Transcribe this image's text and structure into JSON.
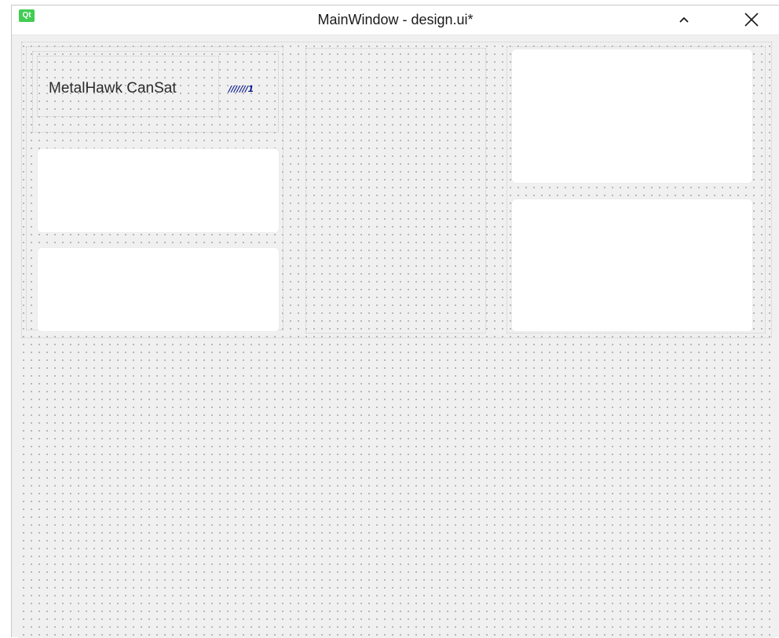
{
  "window": {
    "logo_text": "Qt",
    "title": "MainWindow - design.ui*"
  },
  "titlebar": {
    "collapse_icon": "chevron-up-icon",
    "close_icon": "close-icon"
  },
  "form": {
    "label": {
      "text": "MetalHawk CanSat"
    },
    "placeholder_widget": {
      "text": "///////1"
    }
  },
  "colors": {
    "window_bg": "#f0f0f0",
    "panel_white": "#ffffff",
    "qt_green": "#41cd52",
    "placeholder_blue": "#0a1a8c"
  }
}
